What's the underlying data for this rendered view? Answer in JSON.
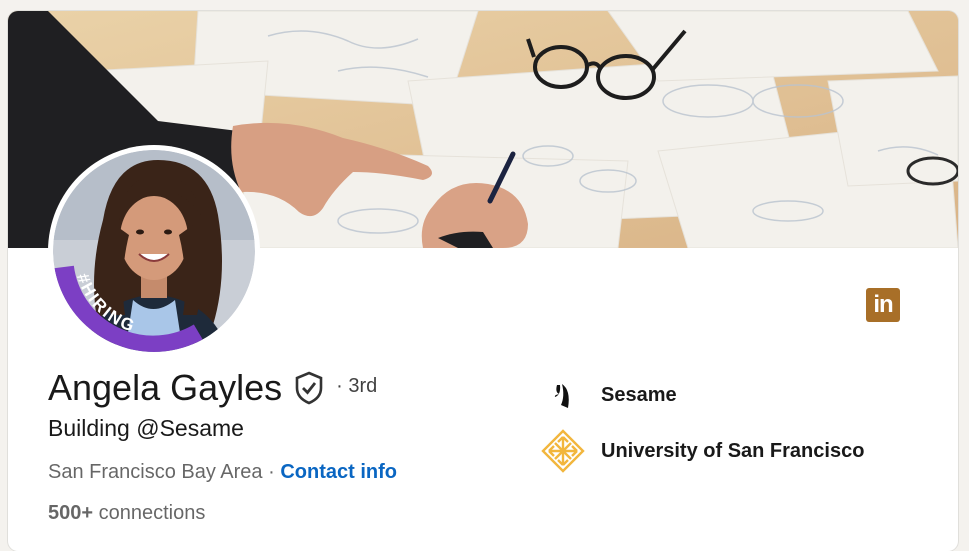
{
  "profile": {
    "name": "Angela Gayles",
    "degree": "· 3rd",
    "headline": "Building @Sesame",
    "location": "San Francisco Bay Area",
    "separator": "·",
    "contact_info": "Contact info",
    "connections_count": "500+",
    "connections_label": "connections",
    "hiring_badge": "#HIRING",
    "verified_icon": "shield-check-icon"
  },
  "organizations": [
    {
      "label": "Sesame",
      "icon": "sesame-logo"
    },
    {
      "label": "University of San Francisco",
      "icon": "usf-logo"
    }
  ],
  "linkedin_badge": {
    "text": "in",
    "color": "#a86f28"
  },
  "colors": {
    "link": "#0a66c2",
    "hiring_purple": "#7c3fc4",
    "usf_gold": "#f2b63d"
  }
}
